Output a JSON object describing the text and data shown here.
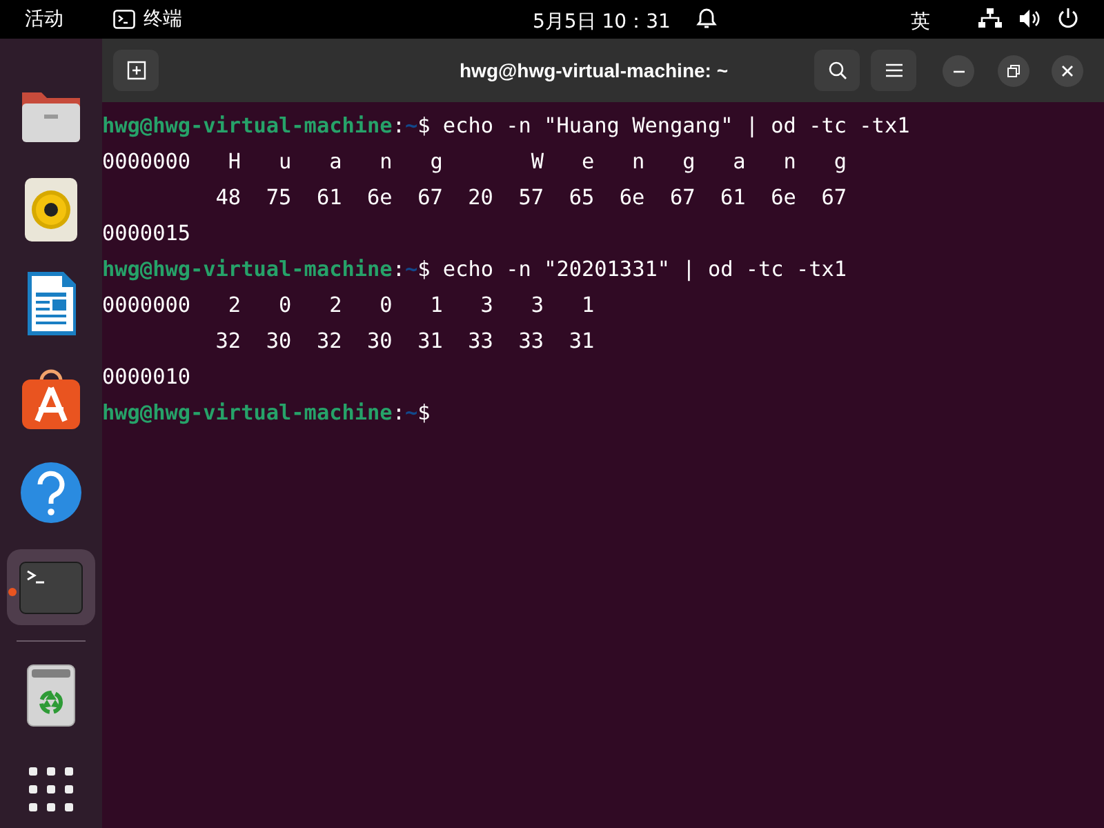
{
  "top_bar": {
    "activities": "活动",
    "app_name": "终端",
    "clock": "5月5日 10：31",
    "input_method": "英"
  },
  "dock": [
    {
      "kind": "files",
      "selected": false,
      "running": false
    },
    {
      "kind": "music",
      "selected": false,
      "running": false
    },
    {
      "kind": "writer",
      "selected": false,
      "running": false
    },
    {
      "kind": "store",
      "selected": false,
      "running": false
    },
    {
      "kind": "help",
      "selected": false,
      "running": false
    },
    {
      "kind": "terminal",
      "selected": true,
      "running": true
    },
    {
      "kind": "separator"
    },
    {
      "kind": "trash",
      "selected": false,
      "running": false
    },
    {
      "kind": "apps",
      "selected": false,
      "running": false
    }
  ],
  "window": {
    "title": "hwg@hwg-virtual-machine: ~"
  },
  "terminal_lines": [
    {
      "kind": "prompt",
      "user_host": "hwg@hwg-virtual-machine",
      "separator": ":",
      "path": "~",
      "symbol": "$",
      "command": "echo -n \"Huang Wengang\" | od -tc -tx1"
    },
    {
      "kind": "output",
      "text": "0000000   H   u   a   n   g       W   e   n   g   a   n   g"
    },
    {
      "kind": "output",
      "text": "         48  75  61  6e  67  20  57  65  6e  67  61  6e  67"
    },
    {
      "kind": "output",
      "text": "0000015"
    },
    {
      "kind": "prompt",
      "user_host": "hwg@hwg-virtual-machine",
      "separator": ":",
      "path": "~",
      "symbol": "$",
      "command": "echo -n \"20201331\" | od -tc -tx1"
    },
    {
      "kind": "output",
      "text": "0000000   2   0   2   0   1   3   3   1"
    },
    {
      "kind": "output",
      "text": "         32  30  32  30  31  33  33  31"
    },
    {
      "kind": "output",
      "text": "0000010"
    },
    {
      "kind": "prompt",
      "user_host": "hwg@hwg-virtual-machine",
      "separator": ":",
      "path": "~",
      "symbol": "$"
    }
  ]
}
